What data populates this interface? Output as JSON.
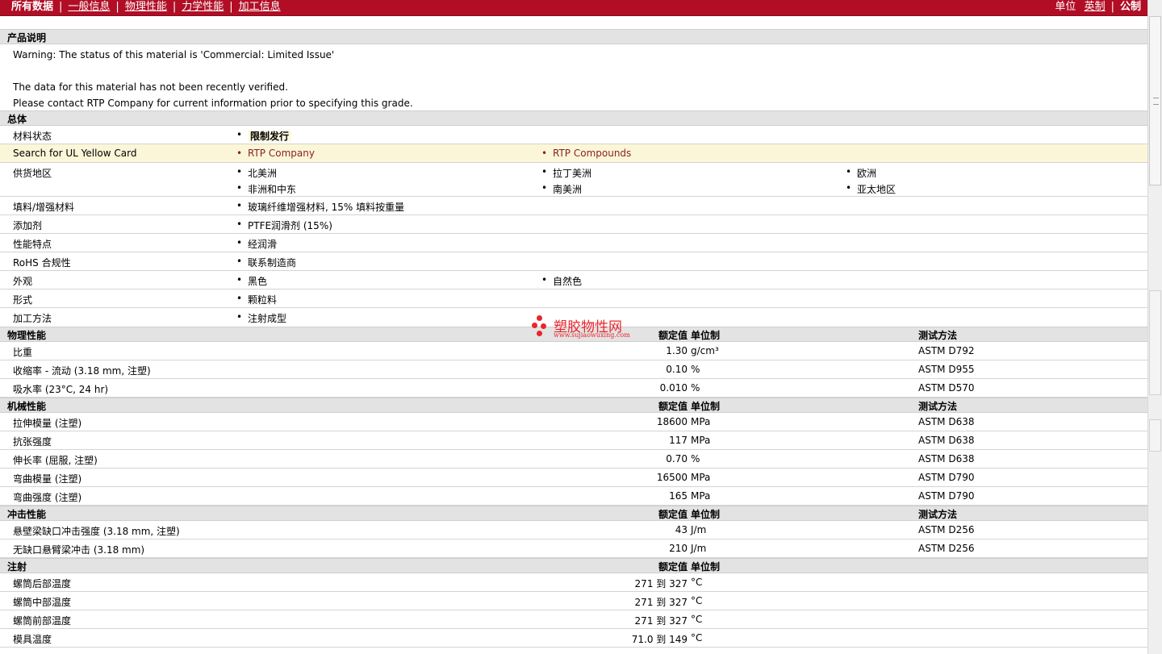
{
  "nav": {
    "all_data": "所有数据",
    "links": [
      "一般信息",
      "物理性能",
      "力学性能",
      "加工信息"
    ],
    "units_label": "单位",
    "unit_english": "英制",
    "unit_metric": "公制"
  },
  "description": {
    "heading": "产品说明",
    "warning": "Warning: The status of this material is 'Commercial: Limited Issue'",
    "line2": "The data for this material has not been recently verified.",
    "line3": "Please contact RTP Company for current information prior to specifying this grade."
  },
  "general": {
    "heading": "总体",
    "status_label": "材料状态",
    "status_value": "限制发行",
    "ul_label": "Search for UL Yellow Card",
    "ul_links": [
      "RTP Company",
      "RTP Compounds"
    ],
    "supply_label": "供货地区",
    "supply": [
      "北美洲",
      "拉丁美洲",
      "欧洲",
      "非洲和中东",
      "南美洲",
      "亚太地区"
    ],
    "filler_label": "填料/增强材料",
    "filler_value": "玻璃纤维增强材料, 15% 填料按重量",
    "additive_label": "添加剂",
    "additive_value": "PTFE润滑剂 (15%)",
    "feature_label": "性能特点",
    "feature_value": "经润滑",
    "rohs_label": "RoHS 合规性",
    "rohs_value": "联系制造商",
    "appearance_label": "外观",
    "appearance": [
      "黑色",
      "自然色"
    ],
    "form_label": "形式",
    "form_value": "颗粒料",
    "process_label": "加工方法",
    "process_value": "注射成型"
  },
  "col_headers": {
    "rated": "额定值",
    "unit": "单位制",
    "test": "测试方法"
  },
  "physical": {
    "heading": "物理性能",
    "rows": [
      {
        "label": "比重",
        "value": "1.30",
        "unit": "g/cm³",
        "test": "ASTM D792"
      },
      {
        "label": "收缩率 - 流动 (3.18 mm, 注塑)",
        "value": "0.10",
        "unit": "%",
        "test": "ASTM D955"
      },
      {
        "label": "吸水率 (23°C, 24 hr)",
        "value": "0.010",
        "unit": "%",
        "test": "ASTM D570"
      }
    ]
  },
  "mechanical": {
    "heading": "机械性能",
    "rows": [
      {
        "label": "拉伸模量 (注塑)",
        "value": "18600",
        "unit": "MPa",
        "test": "ASTM D638"
      },
      {
        "label": "抗张强度",
        "value": "117",
        "unit": "MPa",
        "test": "ASTM D638"
      },
      {
        "label": "伸长率 (屈服, 注塑)",
        "value": "0.70",
        "unit": "%",
        "test": "ASTM D638"
      },
      {
        "label": "弯曲模量 (注塑)",
        "value": "16500",
        "unit": "MPa",
        "test": "ASTM D790"
      },
      {
        "label": "弯曲强度 (注塑)",
        "value": "165",
        "unit": "MPa",
        "test": "ASTM D790"
      }
    ]
  },
  "impact": {
    "heading": "冲击性能",
    "rows": [
      {
        "label": "悬壁梁缺口冲击强度 (3.18 mm, 注塑)",
        "value": "43",
        "unit": "J/m",
        "test": "ASTM D256"
      },
      {
        "label": "无缺口悬臂梁冲击 (3.18 mm)",
        "value": "210",
        "unit": "J/m",
        "test": "ASTM D256"
      }
    ]
  },
  "injection": {
    "heading": "注射",
    "rows": [
      {
        "label": "螺筒后部温度",
        "value": "271 到  327",
        "unit": "°C"
      },
      {
        "label": "螺筒中部温度",
        "value": "271 到  327",
        "unit": "°C"
      },
      {
        "label": "螺筒前部温度",
        "value": "271 到  327",
        "unit": "°C"
      },
      {
        "label": "模具温度",
        "value": "71.0 到  149",
        "unit": "°C"
      }
    ]
  },
  "watermark": {
    "title": "塑胶物性网",
    "url": "www.sujiaowuxing.com"
  },
  "colors": {
    "topbar": "#b10e26",
    "section_bg": "#e3e3e3",
    "highlight_row": "#fbf6d8",
    "link_red": "#8a1f1f",
    "watermark": "#e8262b"
  }
}
